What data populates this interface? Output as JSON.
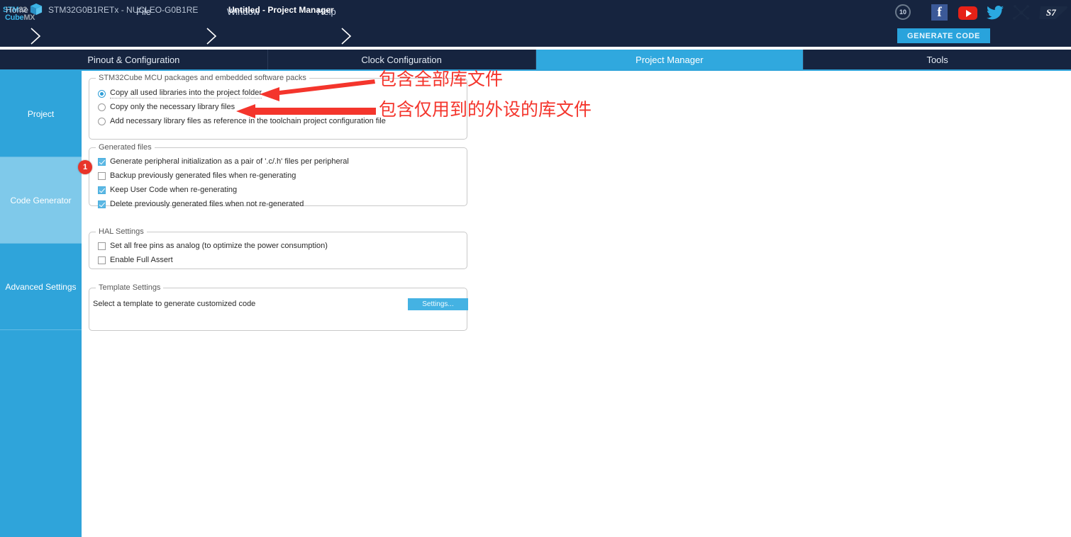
{
  "app": {
    "logo_line1_bold": "STM",
    "logo_line1_gray": "32",
    "logo_line2_bold": "Cube",
    "logo_line2_gray": "MX",
    "cube_icon": "cube-icon"
  },
  "menubar": {
    "items": [
      {
        "label": "File",
        "name": "menu-file"
      },
      {
        "label": "Window",
        "name": "menu-window"
      },
      {
        "label": "Help",
        "name": "menu-help"
      }
    ],
    "social": [
      {
        "name": "anniversary-badge-icon",
        "label": "10"
      },
      {
        "name": "facebook-icon",
        "label": "f"
      },
      {
        "name": "youtube-icon",
        "label": ""
      },
      {
        "name": "twitter-icon",
        "label": ""
      },
      {
        "name": "st-community-icon",
        "label": ""
      },
      {
        "name": "st-logo-icon",
        "label": ""
      }
    ]
  },
  "breadcrumb": {
    "home": "Home",
    "mcu": "STM32G0B1RETx  -  NUCLEO-G0B1RE",
    "project": "Untitled - Project Manager",
    "generate_button": "GENERATE CODE"
  },
  "tabs": [
    {
      "label": "Pinout & Configuration",
      "name": "tab-pinout-configuration",
      "active": false
    },
    {
      "label": "Clock Configuration",
      "name": "tab-clock-configuration",
      "active": false
    },
    {
      "label": "Project Manager",
      "name": "tab-project-manager",
      "active": true
    },
    {
      "label": "Tools",
      "name": "tab-tools",
      "active": false
    }
  ],
  "sidebar": {
    "items": [
      {
        "label": "Project",
        "name": "sidebar-item-project",
        "selected": false
      },
      {
        "label": "Code Generator",
        "name": "sidebar-item-code-generator",
        "selected": true
      },
      {
        "label": "Advanced Settings",
        "name": "sidebar-item-advanced-settings",
        "selected": false
      }
    ]
  },
  "panels": {
    "packages": {
      "title": "STM32Cube MCU packages and embedded software packs",
      "options": [
        {
          "label": "Copy all used libraries into the project folder",
          "selected": true
        },
        {
          "label": "Copy only the necessary library files",
          "selected": false
        },
        {
          "label": "Add necessary library files as reference in the toolchain project configuration file",
          "selected": false
        }
      ]
    },
    "generated_files": {
      "title": "Generated files",
      "options": [
        {
          "label": "Generate peripheral initialization as a pair of '.c/.h' files per peripheral",
          "checked": true
        },
        {
          "label": "Backup previously generated files when re-generating",
          "checked": false
        },
        {
          "label": "Keep User Code when re-generating",
          "checked": true
        },
        {
          "label": "Delete previously generated files when not re-generated",
          "checked": true
        }
      ]
    },
    "hal_settings": {
      "title": "HAL Settings",
      "options": [
        {
          "label": "Set all free pins as analog (to optimize the power consumption)",
          "checked": false
        },
        {
          "label": "Enable Full Assert",
          "checked": false
        }
      ]
    },
    "template_settings": {
      "title": "Template Settings",
      "description": "Select a template to generate customized code",
      "button": "Settings..."
    }
  },
  "annotations": {
    "badge_number": "1",
    "note_all_libraries": "包含全部库文件",
    "note_only_used_libraries": "包含仅用到的外设的库文件",
    "accent_red": "#f4352c"
  },
  "colors": {
    "header_navy": "#16243f",
    "accent_blue": "#2fa4da",
    "active_tab_blue": "#30a8de",
    "sidebar_selected": "#7fc9ea",
    "annotation_red": "#f4352c",
    "badge_red": "#e8342a"
  }
}
